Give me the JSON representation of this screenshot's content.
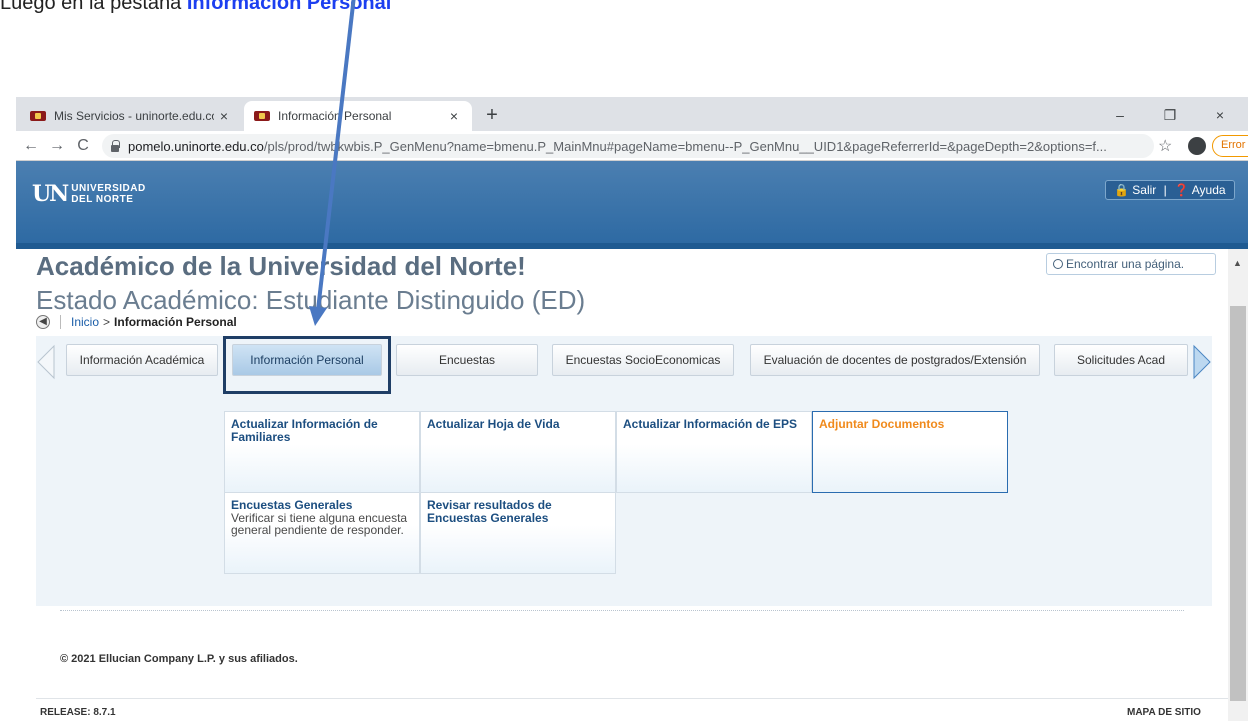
{
  "instruction": {
    "text_before": "Luego en la pestaña ",
    "highlight": "Información Personal"
  },
  "browser": {
    "tabs": [
      {
        "title": "Mis Servicios - uninorte.edu.co",
        "close": "×"
      },
      {
        "title": "Información Personal",
        "close": "×"
      }
    ],
    "new_tab": "+",
    "window_controls": {
      "minimize": "–",
      "restore": "❐",
      "close": "×"
    },
    "nav": {
      "back": "←",
      "forward": "→",
      "reload": "C"
    },
    "url_host": "pomelo.uninorte.edu.co",
    "url_path": "/pls/prod/twbkwbis.P_GenMenu?name=bmenu.P_MainMnu#pageName=bmenu--P_GenMnu__UID1&pageReferrerId=&pageDepth=2&options=f...",
    "star": "☆",
    "error_label": "Error",
    "error_menu": "⋮"
  },
  "header": {
    "logo_mark": "UN",
    "logo_line1": "UNIVERSIDAD",
    "logo_line2": "DEL NORTE",
    "exit_label": "Salir",
    "help_label": "Ayuda",
    "separator": "|"
  },
  "page": {
    "welcome": "Académico de la Universidad del Norte!",
    "status": "Estado Académico: Estudiante Distinguido (ED)",
    "search_placeholder": "Encontrar una página.",
    "breadcrumb": {
      "home": "Inicio",
      "separator": ">",
      "current": "Información Personal"
    }
  },
  "menu_tabs": [
    {
      "label": "Información Académica"
    },
    {
      "label": "Información Personal",
      "selected": true
    },
    {
      "label": "Encuestas"
    },
    {
      "label": "Encuestas SocioEconomicas"
    },
    {
      "label": "Evaluación de docentes de postgrados/Extensión"
    },
    {
      "label": "Solicitudes Acad"
    }
  ],
  "tiles": [
    {
      "title": "Actualizar Información de Familiares",
      "desc": ""
    },
    {
      "title": "Actualizar Hoja de Vida",
      "desc": ""
    },
    {
      "title": "Actualizar Información de EPS",
      "desc": ""
    },
    {
      "title": "Adjuntar Documentos",
      "desc": "",
      "highlight": true
    },
    {
      "title": "Encuestas Generales",
      "desc": "Verificar si tiene alguna encuesta general pendiente de responder."
    },
    {
      "title": "Revisar resultados de Encuestas Generales",
      "desc": ""
    }
  ],
  "footer": {
    "copyright": "© 2021 Ellucian Company L.P. y sus afiliados.",
    "release": "RELEASE: 8.7.1",
    "sitemap": "MAPA DE SITIO"
  },
  "colors": {
    "header_blue": "#2e6aa3",
    "tab_frame": "#1f3e66",
    "annotation_arrow": "#4a78c2",
    "highlight_text": "#1c3ff0",
    "tile_highlight_title": "#f08a1c"
  }
}
